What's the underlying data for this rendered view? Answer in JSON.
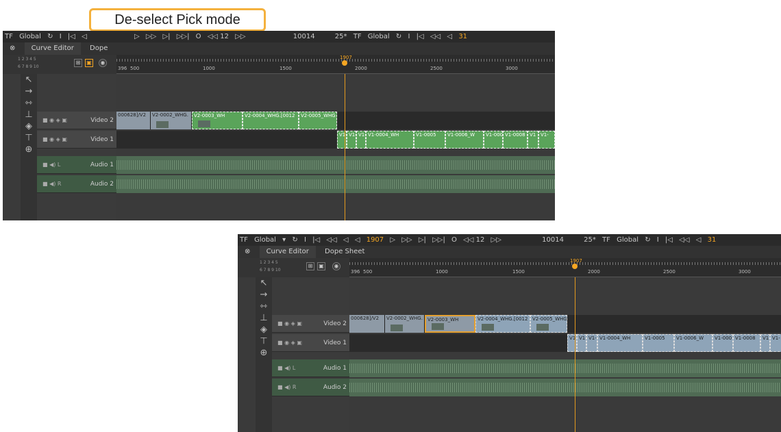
{
  "callout": {
    "text": "De-select Pick mode"
  },
  "colors": {
    "accent": "#f5a623",
    "pick_clip": "#5aa45a",
    "selected_outline": "#e5a030"
  },
  "toolbar": {
    "items": [
      "TF",
      "Global",
      "▾",
      "↻",
      "I",
      "|◁",
      "◁◁",
      "◁",
      "◁",
      "1907",
      "▷",
      "▷▷",
      "▷|",
      "▷▷|",
      "O",
      "◁◁ 12",
      "▷▷"
    ],
    "frame": "1907",
    "timecode": "10014",
    "fps": "25*",
    "right": [
      "TF",
      "Global",
      "↻",
      "I",
      "|◁",
      "◁◁",
      "◁",
      "31"
    ]
  },
  "tabs": {
    "curve_editor": "Curve Editor",
    "dope_sheet": "Dope Sheet",
    "dope_short": "Dope"
  },
  "controls": {
    "row1": "1 2 3 4 5",
    "row2": "6 7 8 9 10"
  },
  "ruler": {
    "ticks": [
      "396",
      "500",
      "1000",
      "1500",
      "2000",
      "2500",
      "3000"
    ],
    "playhead_label": "1907"
  },
  "sidebar_icons": [
    "select-arrow-icon",
    "track-arrow-icon",
    "slip-icon",
    "slide-icon",
    "blade-icon",
    "ripple-icon",
    "zoom-icon"
  ],
  "tracks": [
    {
      "name": "Video 2",
      "icons": "■ ◉ ◈ ▣"
    },
    {
      "name": "Video 1",
      "icons": "■ ◉ ◈ ▣"
    },
    {
      "name": "Audio 1",
      "icons": "■ ◀) L"
    },
    {
      "name": "Audio 2",
      "icons": "■ ◀) R"
    }
  ],
  "clips_v2": [
    "000628]/V2",
    "V2-0002_WHG.",
    "V2-0003_WH",
    "V2-0004_WHG.[0012",
    "V2-0005_WHG"
  ],
  "clips_v1": [
    "V1-",
    "V1-",
    "V1-",
    "V1-0004_WH",
    "V1-0005",
    "V1-0006_W",
    "V1-000",
    "V1-0008",
    "V1",
    "V1-"
  ]
}
